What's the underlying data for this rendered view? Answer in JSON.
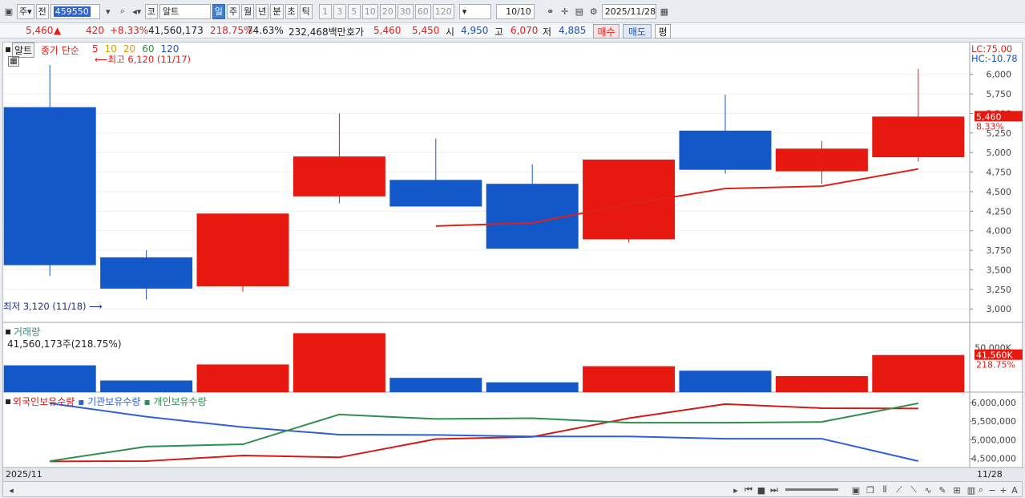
{
  "toolbar": {
    "market": "주",
    "prefix": "전",
    "code": "459550",
    "exchange": "코",
    "name": "알트",
    "periods": [
      "일",
      "주",
      "월",
      "년",
      "분",
      "초",
      "틱"
    ],
    "active_period": "일",
    "intervals": [
      "1",
      "3",
      "5",
      "10",
      "20",
      "30",
      "60",
      "120"
    ],
    "count": "10",
    "count_total": "/10",
    "date": "2025/11/28"
  },
  "quote": {
    "price": "5,460",
    "arrow": "▲",
    "change": "420",
    "change_pct": "+8.33%",
    "volume": "41,560,173",
    "vol_ratio": "218.75%",
    "turnover": "74.63%",
    "amount": "232,468백만",
    "bid_label": "호가",
    "ask_price": "5,460",
    "bid_price": "5,450",
    "open_label": "시",
    "open": "4,950",
    "high_label": "고",
    "high": "6,070",
    "low_label": "저",
    "low": "4,885",
    "buy_label": "매수",
    "sell_label": "매도",
    "eval_label": "평"
  },
  "price_panel": {
    "tag": "알트",
    "ma_title": "종가 단순",
    "ma_periods": [
      "5",
      "10",
      "20",
      "60",
      "120"
    ],
    "ma_colors": [
      "#e0201a",
      "#d4a000",
      "#e39500",
      "#2f8d3a",
      "#1a52c4"
    ],
    "lc_label": "LC:75.00",
    "hc_label": "HC:-10.78",
    "current_tag": "5,460",
    "current_pct": "8.33%",
    "high_note": "최고 6,120 (11/17)",
    "low_note": "최저 3,120 (11/18)"
  },
  "volume_panel": {
    "title": "거래량",
    "value_text": "41,560,173주(218.75%)",
    "current_tag": "41,560K",
    "current_pct": "218.75%",
    "tick_label": "50,000K"
  },
  "holdings_panel": {
    "titles": [
      "외국인보유수량",
      "기관보유수량",
      "개인보유수량"
    ]
  },
  "footer": {
    "left_date": "2025/11",
    "right_date": "11/28"
  },
  "colors": {
    "up": "#e6180f",
    "down": "#1358c8",
    "foreign": "#d41a18",
    "institution": "#2f5fd8",
    "individual": "#2f8d4e"
  },
  "chart_data": [
    {
      "type": "candlestick",
      "ylim": [
        2900,
        6120
      ],
      "yticks": [
        3000,
        3250,
        3500,
        3750,
        4000,
        4250,
        4500,
        4750,
        5000,
        5250,
        5500,
        5750,
        6000
      ],
      "candles": [
        {
          "open": 5580,
          "high": 6120,
          "low": 3420,
          "close": 3560
        },
        {
          "open": 3660,
          "high": 3750,
          "low": 3120,
          "close": 3260
        },
        {
          "open": 3290,
          "high": 3240,
          "low": 3220,
          "close": 4220
        },
        {
          "open": 4440,
          "high": 5500,
          "low": 4350,
          "close": 4950
        },
        {
          "open": 4650,
          "high": 5180,
          "low": 4650,
          "close": 4310
        },
        {
          "open": 4600,
          "high": 4850,
          "low": 3800,
          "close": 3770
        },
        {
          "open": 3890,
          "high": 4910,
          "low": 3850,
          "close": 4910
        },
        {
          "open": 5280,
          "high": 5740,
          "low": 4730,
          "close": 4780
        },
        {
          "open": 4760,
          "high": 5150,
          "low": 4600,
          "close": 5050
        },
        {
          "open": 4940,
          "high": 6070,
          "low": 4885,
          "close": 5460
        }
      ],
      "ma5": [
        null,
        null,
        null,
        null,
        4060,
        4100,
        4340,
        4540,
        4570,
        4790
      ]
    },
    {
      "type": "bar",
      "title": "거래량",
      "ylim": [
        0,
        70000
      ],
      "values": [
        30000,
        13000,
        31000,
        66000,
        16000,
        11000,
        29000,
        24000,
        18000,
        41560
      ],
      "colors": [
        "down",
        "down",
        "up",
        "up",
        "down",
        "down",
        "up",
        "down",
        "up",
        "up"
      ]
    },
    {
      "type": "line",
      "ylim": [
        4300000,
        6150000
      ],
      "yticks": [
        4500000,
        5000000,
        5500000,
        6000000
      ],
      "series": [
        {
          "name": "외국인보유수량",
          "values": [
            4420000,
            4430000,
            4580000,
            4530000,
            5020000,
            5080000,
            5580000,
            5960000,
            5850000,
            5840000
          ]
        },
        {
          "name": "기관보유수량",
          "values": [
            5980000,
            5620000,
            5340000,
            5140000,
            5130000,
            5090000,
            5090000,
            5030000,
            5030000,
            4430000
          ]
        },
        {
          "name": "개인보유수량",
          "values": [
            4430000,
            4820000,
            4880000,
            5680000,
            5560000,
            5580000,
            5460000,
            5460000,
            5480000,
            5980000
          ]
        }
      ]
    }
  ]
}
